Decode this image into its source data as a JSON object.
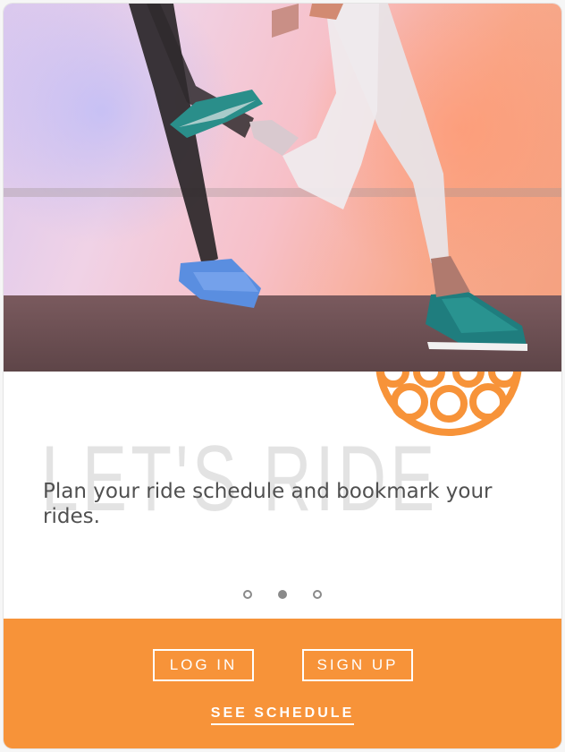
{
  "hero": {
    "image_alt": ""
  },
  "content": {
    "watermark": "LET'S RIDE",
    "tagline": "Plan your ride schedule and bookmark your rides."
  },
  "pager": {
    "count": 3,
    "active_index": 1
  },
  "actions": {
    "login_label": "LOG IN",
    "signup_label": "SIGN UP",
    "schedule_label": "SEE SCHEDULE"
  },
  "colors": {
    "accent": "#f79339",
    "dot": "#8a8a8a",
    "tagline": "#505050",
    "watermark": "#e3e3e3"
  },
  "icons": {
    "logo": "wheel-logo-icon"
  }
}
